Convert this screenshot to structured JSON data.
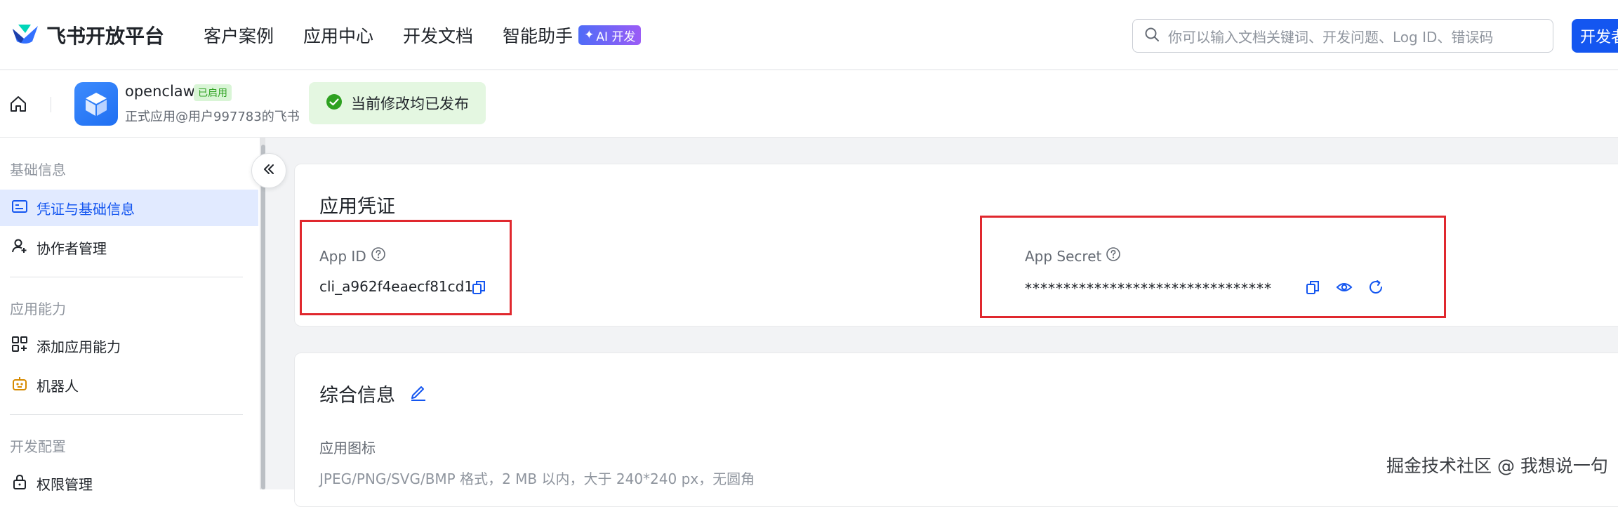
{
  "brand": {
    "name": "飞书开放平台"
  },
  "nav": {
    "items": [
      "客户案例",
      "应用中心",
      "开发文档",
      "智能助手"
    ],
    "ai_badge": "AI 开发",
    "search_placeholder": "你可以输入文档关键词、开发问题、Log ID、错误码",
    "dev_button": "开发者"
  },
  "app": {
    "name": "openclaw",
    "status": "已启用",
    "subtitle": "正式应用@用户997783的飞书",
    "publish_status": "当前修改均已发布"
  },
  "sidebar": {
    "groups": {
      "basic": "基础信息",
      "capability": "应用能力",
      "dev_config": "开发配置"
    },
    "items": {
      "credentials": "凭证与基础信息",
      "collaborators": "协作者管理",
      "add_capability": "添加应用能力",
      "bot": "机器人",
      "permissions": "权限管理"
    }
  },
  "credentials_card": {
    "title": "应用凭证",
    "app_id_label": "App ID",
    "app_id_value": "cli_a962f4eaecf81cd1",
    "app_secret_label": "App Secret",
    "app_secret_value": "********************************"
  },
  "info_card": {
    "title": "综合信息",
    "icon_label": "应用图标",
    "icon_hint": "JPEG/PNG/SVG/BMP 格式，2 MB 以内，大于 240*240 px，无圆角"
  },
  "watermark": "掘金技术社区 @ 我想说一句",
  "colors": {
    "primary": "#1456f0",
    "active_bg": "#e1eaff",
    "success": "#2ea121",
    "highlight_box": "#e0282e"
  }
}
